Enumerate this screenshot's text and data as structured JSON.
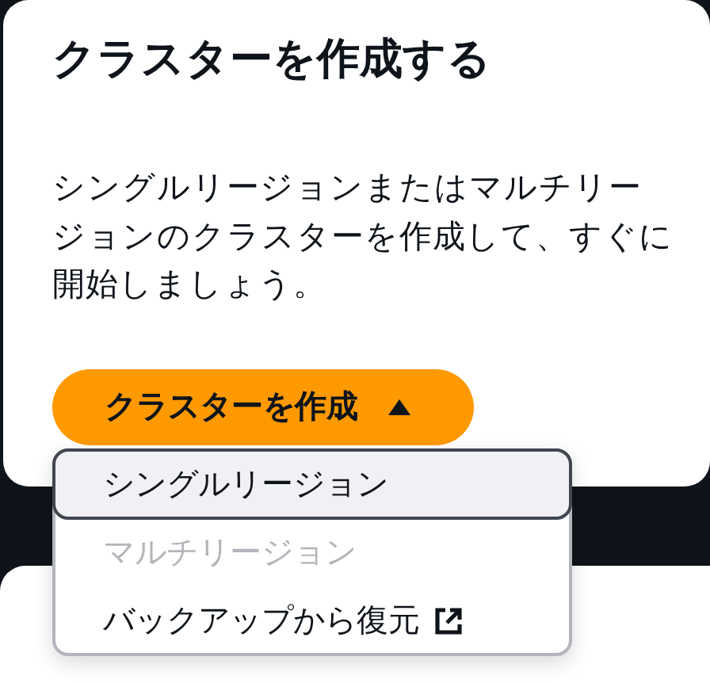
{
  "card": {
    "title": "クラスターを作成する",
    "description": "シングルリージョンまたはマルチリージョンのクラスターを作成して、すぐに開始しましょう。"
  },
  "create_button": {
    "label": "クラスターを作成",
    "expanded": true
  },
  "menu_items": [
    {
      "label": "シングルリージョン",
      "selected": true,
      "disabled": false,
      "external": false
    },
    {
      "label": "マルチリージョン",
      "selected": false,
      "disabled": true,
      "external": false
    },
    {
      "label": "バックアップから復元",
      "selected": false,
      "disabled": false,
      "external": true
    }
  ]
}
